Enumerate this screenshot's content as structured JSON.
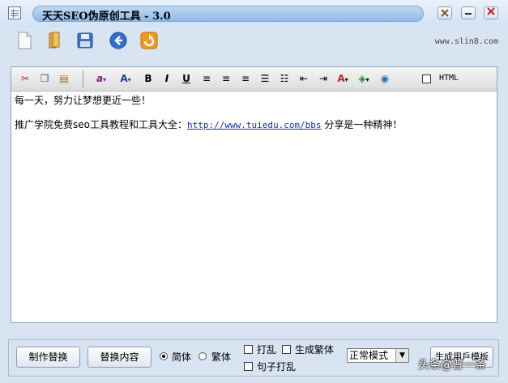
{
  "window": {
    "title": "天天SEO伪原创工具 - 3.0"
  },
  "toolbar": {
    "site_text": "www.slin8.com"
  },
  "editor": {
    "html_label": "HTML",
    "line1": "每一天，努力让梦想更近一些！",
    "line2_prefix": "推广学院免费seo工具教程和工具大全：",
    "line2_link": "http://www.tuiedu.com/bbs",
    "line2_suffix": "分享是一种精神！"
  },
  "bottom": {
    "btn_make_replace": "制作替换",
    "btn_replace_content": "替换内容",
    "radio_simplified": "简体",
    "radio_traditional": "繁体",
    "chk_shuffle": "打乱",
    "chk_gen_traditional": "生成繁体",
    "chk_sentence_shuffle": "句子打乱",
    "mode_selected": "正常模式",
    "btn_generate": "生成用戶模板"
  },
  "watermark": "头条@普一条",
  "colors": {
    "title_bar": "#d3e1f1",
    "title_pill": "#8fb9e6",
    "link": "#1a2fb0",
    "background": "#d8e4f2"
  }
}
